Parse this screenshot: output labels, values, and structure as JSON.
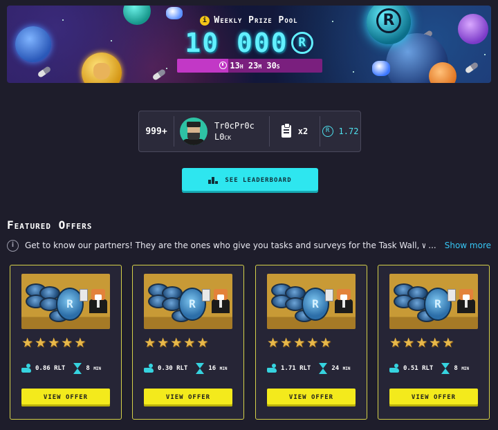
{
  "prize_pool": {
    "title": "Weekly Prize Pool",
    "amount": "10 000",
    "currency_symbol": "R",
    "timer": "13h 23m 30s",
    "timer_fill_percent": 35
  },
  "user": {
    "rank": "999+",
    "name_line1": "Tr0cPr0c",
    "name_line2": "L0ck",
    "tasks_count": "x2",
    "balance_symbol": "R",
    "balance": "1.72"
  },
  "leaderboard_button": {
    "label": "SEE LEADERBOARD"
  },
  "featured": {
    "title": "Featured Offers",
    "info_icon": "i",
    "info_text": "Get to know our partners! They are the ones who give you tasks and surveys for the Task Wall, which will help",
    "ellipsis": "...",
    "show_more": "Show more",
    "offers": [
      {
        "reward": "0.86 RLT",
        "duration": "8 min",
        "rating": 5,
        "button": "VIEW OFFER"
      },
      {
        "reward": "0.30 RLT",
        "duration": "16 min",
        "rating": 5,
        "button": "VIEW OFFER"
      },
      {
        "reward": "1.71 RLT",
        "duration": "24 min",
        "rating": 5,
        "button": "VIEW OFFER"
      },
      {
        "reward": "0.51 RLT",
        "duration": "8 min",
        "rating": 5,
        "button": "VIEW OFFER"
      }
    ]
  },
  "colors": {
    "background": "#1e1d2b",
    "accent_cyan": "#2ee6ef",
    "offer_border": "#d6d24a",
    "offer_button": "#f3ea1c",
    "star": "#e7b84a",
    "link": "#36c6f4",
    "timer": "#c238c6"
  }
}
